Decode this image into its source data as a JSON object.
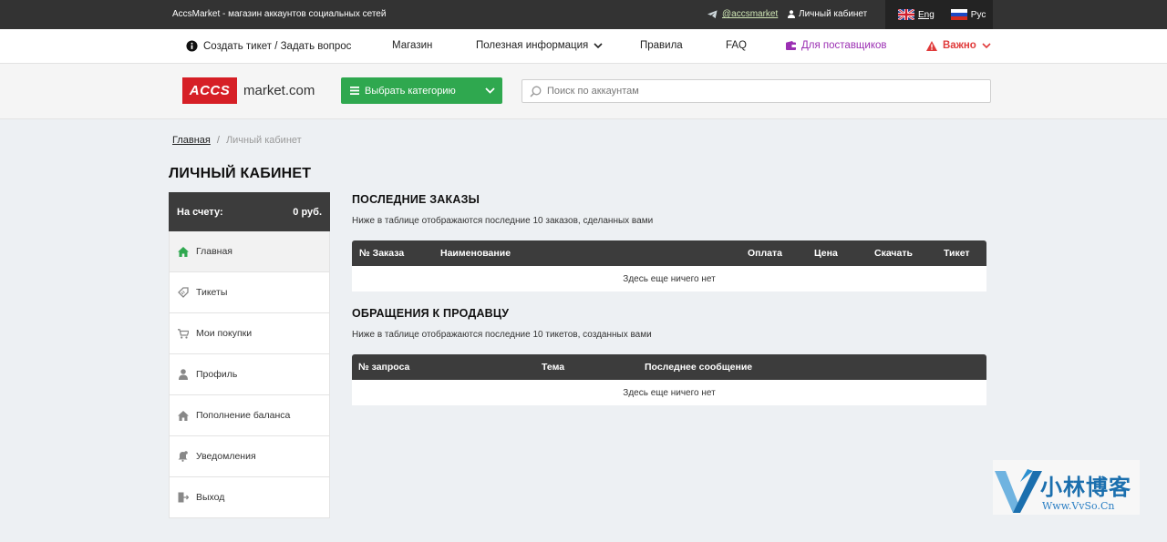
{
  "topbar": {
    "site_title": "AccsMarket - магазин аккаунтов социальных сетей",
    "telegram": "@accsmarket",
    "cabinet": "Личный кабинет",
    "lang_eng": "Eng",
    "lang_rus": "Рус"
  },
  "nav": {
    "ticket": "Создать тикет / Задать вопрос",
    "shop": "Магазин",
    "info": "Полезная информация",
    "rules": "Правила",
    "faq": "FAQ",
    "suppliers": "Для поставщиков",
    "important": "Важно"
  },
  "header": {
    "logo_box": "ACCS",
    "logo_text": "market.com",
    "category_button": "Выбрать категорию",
    "search_placeholder": "Поиск по аккаунтам"
  },
  "breadcrumb": {
    "home": "Главная",
    "current": "Личный кабинет"
  },
  "page_title": "ЛИЧНЫЙ КАБИНЕТ",
  "balance": {
    "label": "На счету:",
    "value": "0 руб."
  },
  "sidebar": {
    "items": [
      {
        "label": "Главная",
        "icon": "home-icon"
      },
      {
        "label": "Тикеты",
        "icon": "ticket-icon"
      },
      {
        "label": "Мои покупки",
        "icon": "cart-icon"
      },
      {
        "label": "Профиль",
        "icon": "user-icon"
      },
      {
        "label": "Пополнение баланса",
        "icon": "wallet-home-icon"
      },
      {
        "label": "Уведомления",
        "icon": "bell-icon"
      },
      {
        "label": "Выход",
        "icon": "exit-icon"
      }
    ]
  },
  "orders": {
    "title": "ПОСЛЕДНИЕ ЗАКАЗЫ",
    "subtitle": "Ниже в таблице отображаются последние 10 заказов, сделанных вами",
    "columns": [
      "№ Заказа",
      "Наименование",
      "Оплата",
      "Цена",
      "Скачать",
      "Тикет"
    ],
    "empty": "Здесь еще ничего нет"
  },
  "tickets": {
    "title": "ОБРАЩЕНИЯ К ПРОДАВЦУ",
    "subtitle": "Ниже в таблице отображаются последние 10 тикетов, созданных вами",
    "columns": [
      "№ запроса",
      "Тема",
      "Последнее сообщение"
    ],
    "empty": "Здесь еще ничего нет"
  },
  "watermark": {
    "name": "小林博客",
    "url": "Www.VvSo.Cn"
  },
  "colors": {
    "topbar": "#333333",
    "accent_green": "#2fa84f",
    "logo_red": "#d61f26",
    "suppliers_purple": "#9b2fb3",
    "important_red": "#e03a3a"
  }
}
